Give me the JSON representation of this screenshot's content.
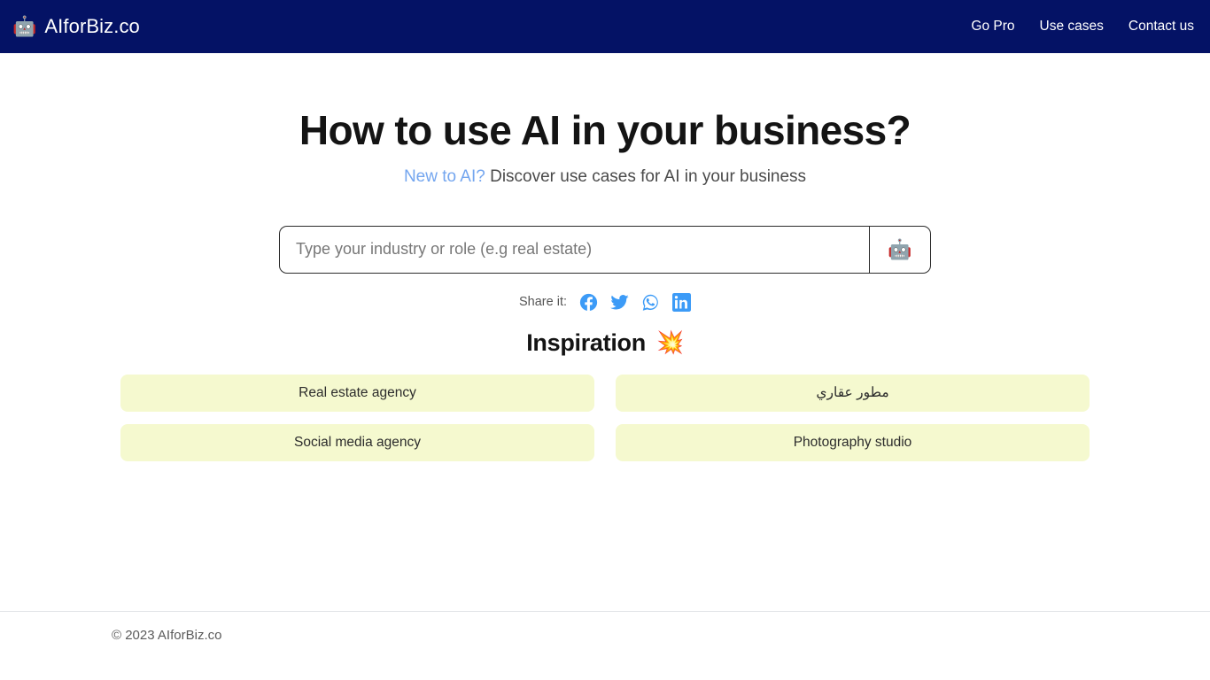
{
  "navbar": {
    "brand": {
      "icon": "robot-icon",
      "glyph": "🤖",
      "text": "AIforBiz.co"
    },
    "links": [
      {
        "label": "Go Pro",
        "name": "nav-link-go-pro"
      },
      {
        "label": "Use cases",
        "name": "nav-link-use-cases"
      },
      {
        "label": "Contact us",
        "name": "nav-link-contact-us"
      }
    ],
    "background_color": "#041265",
    "text_color": "#ffffff"
  },
  "hero": {
    "title": "How to use AI in your business?",
    "subtitle_link": "New to AI?",
    "subtitle_rest": " Discover use cases for AI in your business",
    "link_color": "#74a6ef"
  },
  "search": {
    "placeholder": "Type your industry or role (e.g real estate)",
    "value": "",
    "submit_icon": "robot-icon",
    "submit_glyph": "🤖"
  },
  "share": {
    "label": "Share it:",
    "icon_color": "#3c9bf7",
    "items": [
      {
        "name": "facebook-icon",
        "label": "Facebook"
      },
      {
        "name": "twitter-icon",
        "label": "Twitter"
      },
      {
        "name": "whatsapp-icon",
        "label": "WhatsApp"
      },
      {
        "name": "linkedin-icon",
        "label": "LinkedIn"
      }
    ]
  },
  "inspiration": {
    "title": "Inspiration",
    "emoji": "💥",
    "emoji_name": "collision-icon",
    "chip_color": "#f5f9cf",
    "chips": [
      {
        "label": "Real estate agency",
        "rtl": false
      },
      {
        "label": "مطور عقاري",
        "rtl": true
      },
      {
        "label": "Social media agency",
        "rtl": false
      },
      {
        "label": "Photography studio",
        "rtl": false
      }
    ]
  },
  "footer": {
    "copyright": "© 2023 AIforBiz.co"
  }
}
